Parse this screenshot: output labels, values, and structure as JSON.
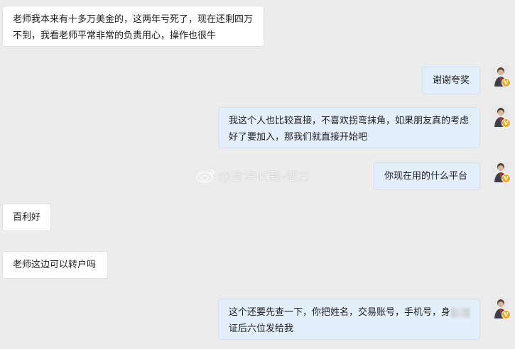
{
  "messages": [
    {
      "side": "left",
      "text": "老师我本来有十多万美金的，这两年亏死了，现在还剩四万不到，我看老师平常非常的负责用心，操作也很牛"
    },
    {
      "side": "right",
      "text": "谢谢夸奖"
    },
    {
      "side": "right",
      "text": "我这个人也比较直接，不喜欢拐弯抹角，如果朋友真的考虑好了要加入，那我们就直接开始吧"
    },
    {
      "side": "right",
      "text": "你现在用的什么平台"
    },
    {
      "side": "left",
      "text": "百利好"
    },
    {
      "side": "left",
      "text": "老师这边可以转户吗"
    },
    {
      "side": "right",
      "text_part1": "这个还要先查一下，你把姓名，交易账号，手机号，身",
      "text_part2": "证后六位发给我"
    }
  ],
  "watermark": {
    "text": "@金油收割-老方",
    "icon": "weibo-icon"
  },
  "avatar_badge": "V",
  "colors": {
    "background": "#ececec",
    "left_bubble": "#ffffff",
    "right_bubble": "#e3effa",
    "badge": "#f5a623"
  }
}
